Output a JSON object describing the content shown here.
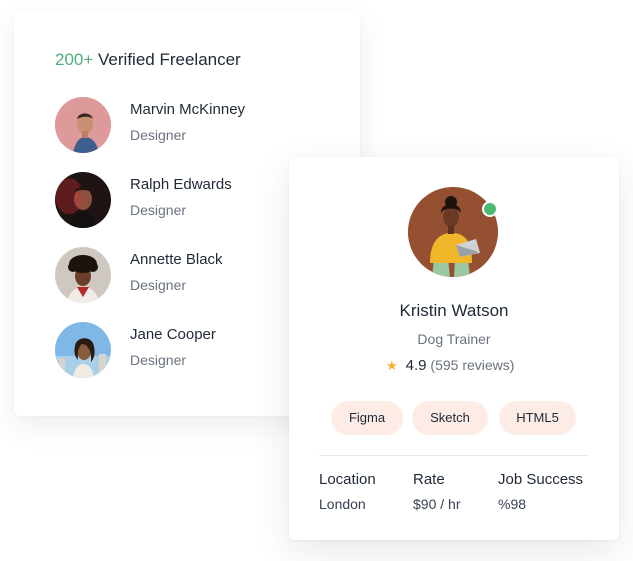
{
  "list_card": {
    "title_count": "200+",
    "title_text": "Verified Freelancer",
    "people": [
      {
        "name": "Marvin McKinney",
        "role": "Designer"
      },
      {
        "name": "Ralph Edwards",
        "role": "Designer"
      },
      {
        "name": "Annette Black",
        "role": "Designer"
      },
      {
        "name": "Jane Cooper",
        "role": "Designer"
      }
    ]
  },
  "profile_card": {
    "name": "Kristin Watson",
    "role": "Dog Trainer",
    "rating": "4.9",
    "reviews": "(595 reviews)",
    "tags": [
      "Figma",
      "Sketch",
      "HTML5"
    ],
    "stats": [
      {
        "label": "Location",
        "value": "London"
      },
      {
        "label": "Rate",
        "value": "$90 / hr"
      },
      {
        "label": "Job Success",
        "value": "%98"
      }
    ]
  },
  "colors": {
    "accent_green": "#4caf7a",
    "online_status": "#4cbb72",
    "star": "#f2b230",
    "tag_bg": "#fdece6"
  }
}
